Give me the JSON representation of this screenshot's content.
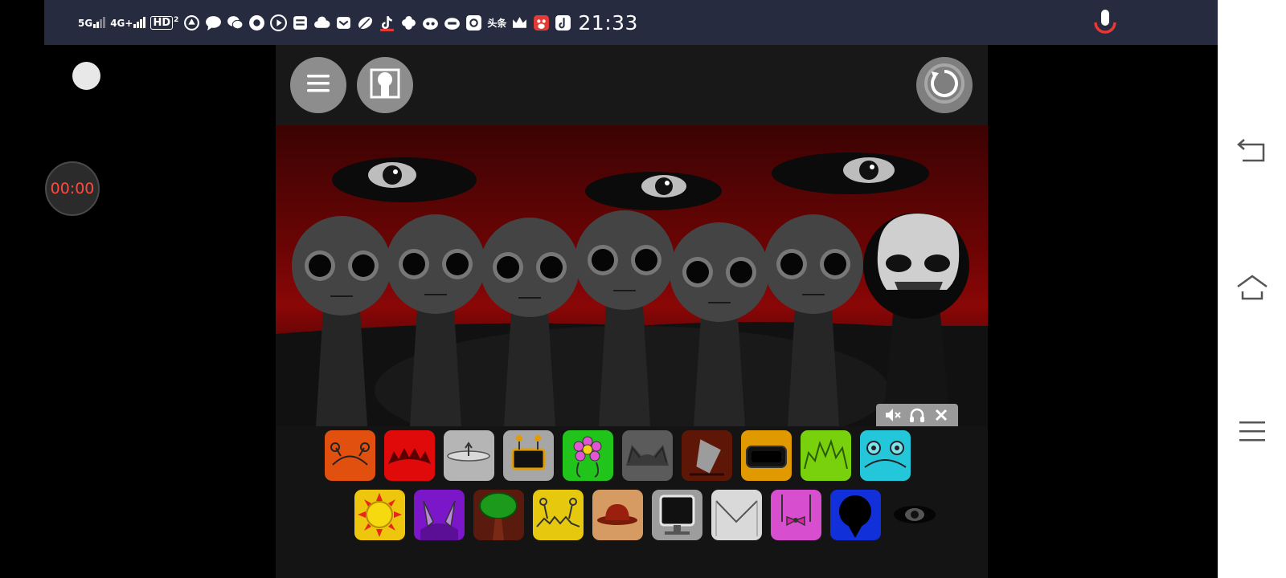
{
  "status_bar": {
    "signal_1": "5G",
    "signal_2": "4G+",
    "hd_badge": "HD",
    "hd_sub": "2",
    "clock": "21:33",
    "app_icons": [
      "rotate-icon",
      "message-icon",
      "wechat-icon",
      "browser-icon",
      "video-icon",
      "news-icon",
      "cloud-icon",
      "mail-icon",
      "feather-icon",
      "tiktok-icon",
      "pinwheel-icon",
      "robot-icon",
      "robot-icon",
      "at-icon",
      "toutiao-icon",
      "crown-icon",
      "baidu-icon",
      "douyin-icon"
    ],
    "toutiao_label": "头条"
  },
  "recorder": {
    "timer": "00:00"
  },
  "game": {
    "top_buttons": [
      "menu-icon",
      "character-icon",
      "reset-icon"
    ],
    "audio_controls": [
      "mute-icon",
      "headphones-icon",
      "close-icon"
    ],
    "palette_row_1": [
      "orange-antenna",
      "red-spikes",
      "gray-dish",
      "gray-robot",
      "green-flower",
      "gray-horns",
      "brown-cup",
      "yellow-visor",
      "lime-zigzag",
      "cyan-bear"
    ],
    "palette_row_2": [
      "yellow-sun",
      "purple-horns",
      "green-tree",
      "yellow-antenna",
      "tan-hat",
      "gray-monitor",
      "white-envelope",
      "pink-bow",
      "blue-ball",
      "dark-eye"
    ]
  },
  "colors": {
    "status_bg": "#262b3f",
    "timer_text": "#ff4a3d",
    "stage_red": "#8a0707",
    "mic_red": "#e53935"
  }
}
